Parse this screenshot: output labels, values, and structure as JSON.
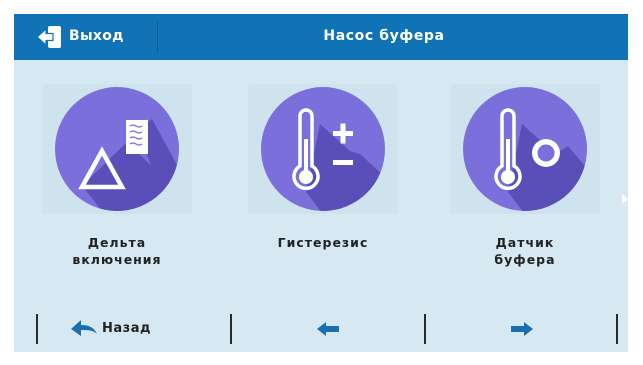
{
  "header": {
    "exit_label": "Выход",
    "title": "Насос буфера"
  },
  "menu": {
    "items": [
      {
        "label": "Дельта\nвключения",
        "icon": "delta-settings-icon"
      },
      {
        "label": "Гистерезис",
        "icon": "thermometer-plus-minus-icon"
      },
      {
        "label": "Датчик\nбуфера",
        "icon": "thermometer-sensor-icon"
      }
    ]
  },
  "footer": {
    "back_label": "Назад",
    "prev_icon": "arrow-left-icon",
    "next_icon": "arrow-right-icon"
  },
  "colors": {
    "header": "#0f73b5",
    "screen_bg": "#d6e9f3",
    "circle": "#7b6fdc",
    "shadow": "#5a4fb8",
    "accent_arrow": "#1a6fb0"
  }
}
